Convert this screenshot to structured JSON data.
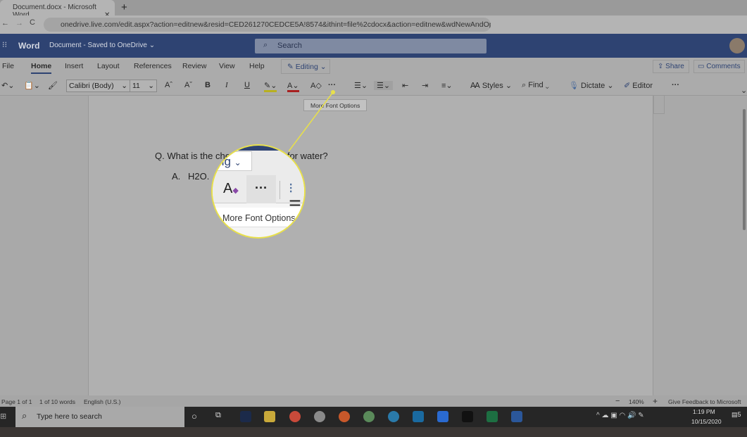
{
  "browser": {
    "tab_title": "Document.docx - Microsoft Word",
    "new_tab": "+",
    "url": "onedrive.live.com/edit.aspx?action=editnew&resid=CED261270CEDCE5A!8574&ithint=file%2cdocx&action=editnew&wdNewAndOp..."
  },
  "header": {
    "app": "Word",
    "doc": "Document - Saved to OneDrive ⌄",
    "search_placeholder": "Search"
  },
  "ribbon": {
    "tabs": [
      "File",
      "Home",
      "Insert",
      "Layout",
      "References",
      "Review",
      "View",
      "Help"
    ],
    "active_tab": "Home",
    "mode": "Editing",
    "share": "Share",
    "comments": "Comments",
    "font": "Calibri (Body)",
    "size": "11",
    "bold": "B",
    "italic": "I",
    "underline": "U",
    "more": "···",
    "styles": "Styles",
    "find": "Find",
    "dictate": "Dictate",
    "editor": "Editor"
  },
  "tooltip": "More Font Options",
  "document": {
    "question": "Q. What is the chemical formula for water?",
    "answer_marker": "A.",
    "answer": "H2O."
  },
  "magnifier": {
    "mode_fragment": "ng",
    "tooltip": "More Font Options"
  },
  "status": {
    "page": "Page 1 of 1",
    "words": "1 of 10 words",
    "language": "English (U.S.)",
    "zoom": "140%",
    "zoom_minus": "−",
    "zoom_plus": "+",
    "feedback": "Give Feedback to Microsoft"
  },
  "taskbar": {
    "search_placeholder": "Type here to search",
    "time": "1:19 PM",
    "date": "10/15/2020",
    "notifications": "5"
  },
  "colors": {
    "word_blue": "#2e4372",
    "highlight": "#e8e04a",
    "excel": "#1d6f42",
    "word_icon": "#2b579a"
  }
}
